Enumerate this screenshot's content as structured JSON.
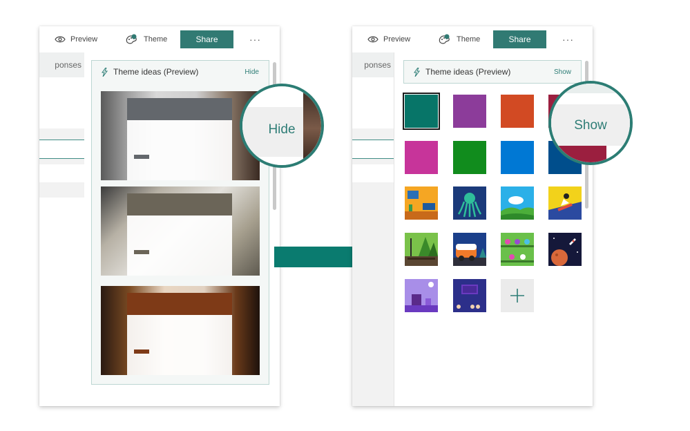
{
  "left_panel": {
    "toolbar": {
      "preview_label": "Preview",
      "theme_label": "Theme",
      "share_label": "Share",
      "more_label": "···"
    },
    "responses_tab": "ponses",
    "theme_ideas": {
      "title": "Theme ideas (Preview)",
      "toggle_label": "Hide"
    },
    "cards": [
      {
        "bar_color": "#63676c",
        "mini_color": "#63676c"
      },
      {
        "bar_color": "#6b6558",
        "mini_color": "#6b6558"
      },
      {
        "bar_color": "#7e3a17",
        "mini_color": "#7e3a17"
      }
    ],
    "bottom_swatches": [
      "#2e7d74",
      "#8a3b9a",
      "#c5512b",
      "#8a2640"
    ],
    "callout_label": "Hide"
  },
  "right_panel": {
    "toolbar": {
      "preview_label": "Preview",
      "theme_label": "Theme",
      "share_label": "Share",
      "more_label": "···"
    },
    "responses_tab": "ponses",
    "theme_ideas": {
      "title": "Theme ideas (Preview)",
      "toggle_label": "Show"
    },
    "color_swatches": [
      {
        "name": "teal",
        "color": "#077568",
        "selected": true
      },
      {
        "name": "purple",
        "color": "#8c3c9a"
      },
      {
        "name": "orange",
        "color": "#d24a23"
      },
      {
        "name": "maroon",
        "color": "#9b1f3f"
      },
      {
        "name": "magenta",
        "color": "#c7349a"
      },
      {
        "name": "green",
        "color": "#118c1d"
      },
      {
        "name": "blue",
        "color": "#0078d4"
      },
      {
        "name": "navy",
        "color": "#004e8c"
      }
    ],
    "image_themes": [
      "room-theme",
      "octopus-theme",
      "landscape-theme",
      "snowboard-theme",
      "forest-theme",
      "camper-theme",
      "lab-theme",
      "space-theme",
      "desk-theme",
      "classroom-theme"
    ],
    "add_theme_icon": "plus-icon",
    "callout_label": "Show"
  },
  "colors": {
    "accent": "#317a73",
    "arrow": "#0a7b6f"
  }
}
